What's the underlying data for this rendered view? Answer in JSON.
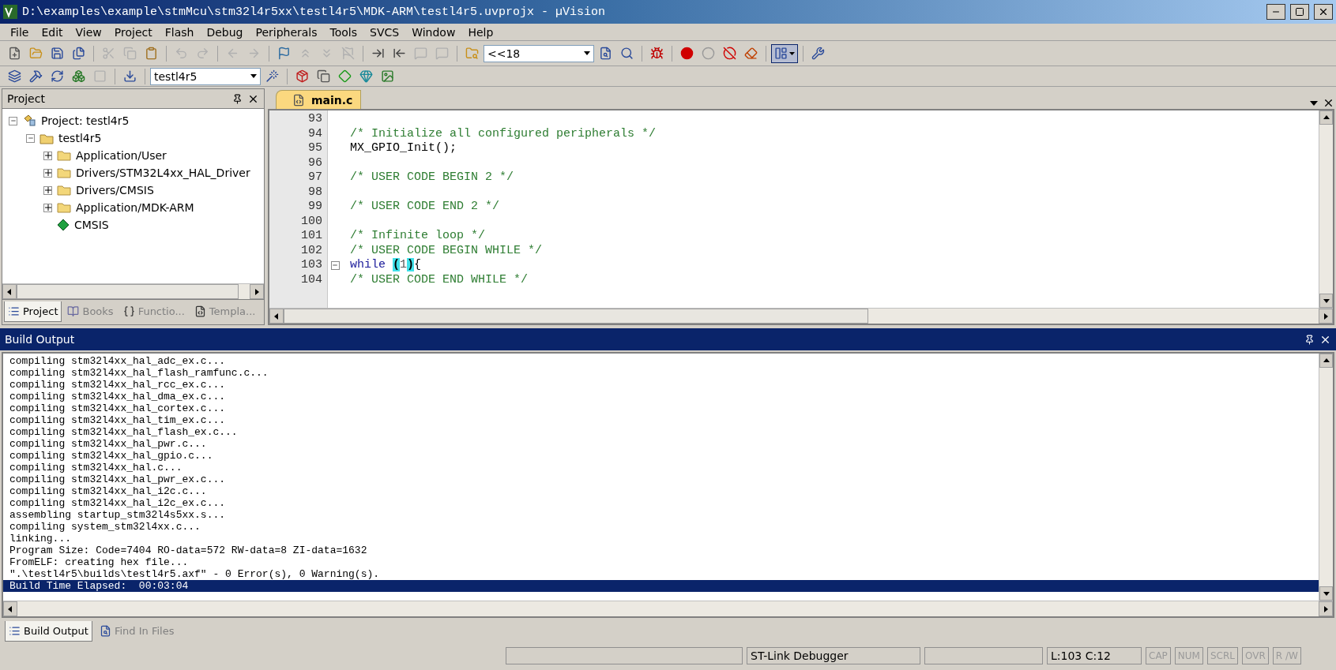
{
  "window": {
    "title": "D:\\examples\\example\\stmMcu\\stm32l4r5xx\\testl4r5\\MDK-ARM\\testl4r5.uvprojx - µVision"
  },
  "menu": [
    "File",
    "Edit",
    "View",
    "Project",
    "Flash",
    "Debug",
    "Peripherals",
    "Tools",
    "SVCS",
    "Window",
    "Help"
  ],
  "toolbar": {
    "buttons": [
      {
        "kind": "new",
        "disabled": false
      },
      {
        "kind": "open",
        "disabled": false
      },
      {
        "kind": "save",
        "disabled": false
      },
      {
        "kind": "saveall",
        "disabled": false
      },
      {
        "kind": "sep"
      },
      {
        "kind": "cut",
        "disabled": true
      },
      {
        "kind": "copy",
        "disabled": true
      },
      {
        "kind": "paste",
        "disabled": false
      },
      {
        "kind": "sep"
      },
      {
        "kind": "undo",
        "disabled": true
      },
      {
        "kind": "redo",
        "disabled": true
      },
      {
        "kind": "sep"
      },
      {
        "kind": "back",
        "disabled": true
      },
      {
        "kind": "forward",
        "disabled": true
      },
      {
        "kind": "sep"
      },
      {
        "kind": "flag",
        "disabled": false
      },
      {
        "kind": "up",
        "disabled": true
      },
      {
        "kind": "down",
        "disabled": true
      },
      {
        "kind": "flagoff",
        "disabled": true
      },
      {
        "kind": "sep"
      },
      {
        "kind": "indent",
        "disabled": false
      },
      {
        "kind": "outdent",
        "disabled": false
      },
      {
        "kind": "comment",
        "disabled": true
      },
      {
        "kind": "uncomment",
        "disabled": true
      },
      {
        "kind": "sep"
      },
      {
        "kind": "findfolder",
        "disabled": false
      },
      {
        "kind": "combo"
      },
      {
        "kind": "filesearch",
        "disabled": false
      },
      {
        "kind": "search",
        "disabled": false
      },
      {
        "kind": "sep"
      },
      {
        "kind": "debug",
        "disabled": false
      },
      {
        "kind": "sep"
      },
      {
        "kind": "breakpoint",
        "disabled": false
      },
      {
        "kind": "breakpointoff",
        "disabled": false
      },
      {
        "kind": "circles",
        "disabled": false
      },
      {
        "kind": "clear",
        "disabled": false
      },
      {
        "kind": "sep"
      },
      {
        "kind": "layout",
        "disabled": false,
        "pressed": true
      },
      {
        "kind": "sep"
      },
      {
        "kind": "wrench",
        "disabled": false
      }
    ],
    "find_combo": "<<18"
  },
  "build_toolbar": {
    "buttons": [
      {
        "kind": "translate",
        "disabled": false
      },
      {
        "kind": "build",
        "disabled": false
      },
      {
        "kind": "rebuild",
        "disabled": false
      },
      {
        "kind": "batch",
        "disabled": false
      },
      {
        "kind": "stop",
        "disabled": true
      },
      {
        "kind": "sep"
      },
      {
        "kind": "download",
        "disabled": false
      },
      {
        "kind": "sep"
      },
      {
        "kind": "combo"
      },
      {
        "kind": "wand",
        "disabled": false
      },
      {
        "kind": "sep"
      },
      {
        "kind": "package",
        "disabled": false
      },
      {
        "kind": "copy",
        "disabled": false
      },
      {
        "kind": "diamond",
        "disabled": false
      },
      {
        "kind": "gem",
        "disabled": false
      },
      {
        "kind": "image",
        "disabled": false
      }
    ],
    "target_combo": "testl4r5"
  },
  "project_panel": {
    "title": "Project",
    "tree": [
      {
        "label": "Project: testl4r5",
        "kind": "project",
        "expanded": true,
        "children": [
          {
            "label": "testl4r5",
            "kind": "target",
            "expanded": true,
            "children": [
              {
                "label": "Application/User",
                "kind": "group",
                "expanded": false
              },
              {
                "label": "Drivers/STM32L4xx_HAL_Driver",
                "kind": "group",
                "expanded": false
              },
              {
                "label": "Drivers/CMSIS",
                "kind": "group",
                "expanded": false
              },
              {
                "label": "Application/MDK-ARM",
                "kind": "group",
                "expanded": false
              },
              {
                "label": "CMSIS",
                "kind": "component"
              }
            ]
          }
        ]
      }
    ],
    "tabs": [
      {
        "label": "Project",
        "kind": "project",
        "selected": true
      },
      {
        "label": "Books",
        "kind": "books",
        "selected": false
      },
      {
        "label": "Functio...",
        "kind": "functions",
        "selected": false
      },
      {
        "label": "Templa...",
        "kind": "templates",
        "selected": false
      }
    ]
  },
  "editor": {
    "tabs": [
      {
        "label": "main.c",
        "selected": true
      }
    ],
    "lines": [
      {
        "number": "93",
        "fold": false
      },
      {
        "number": "94",
        "fold": false,
        "segments": [
          {
            "text": "/* Initialize all configured peripherals */",
            "kind": "comment"
          }
        ]
      },
      {
        "number": "95",
        "fold": false,
        "segments": [
          {
            "text": "MX_GPIO_Init();",
            "kind": "code"
          }
        ]
      },
      {
        "number": "96",
        "fold": false
      },
      {
        "number": "97",
        "fold": false,
        "segments": [
          {
            "text": "/* USER CODE BEGIN 2 */",
            "kind": "comment"
          }
        ]
      },
      {
        "number": "98",
        "fold": false
      },
      {
        "number": "99",
        "fold": false,
        "segments": [
          {
            "text": "/* USER CODE END 2 */",
            "kind": "comment"
          }
        ]
      },
      {
        "number": "100",
        "fold": false
      },
      {
        "number": "101",
        "fold": false,
        "segments": [
          {
            "text": "/* Infinite loop */",
            "kind": "comment"
          }
        ]
      },
      {
        "number": "102",
        "fold": false,
        "segments": [
          {
            "text": "/* USER CODE BEGIN WHILE */",
            "kind": "comment"
          }
        ]
      },
      {
        "number": "103",
        "fold": true,
        "segments": [
          {
            "text": "while ",
            "kind": "keyword"
          },
          {
            "text": "(",
            "kind": "match"
          },
          {
            "text": "1",
            "kind": "number"
          },
          {
            "text": ")",
            "kind": "match"
          },
          {
            "text": "{",
            "kind": "code"
          }
        ]
      },
      {
        "number": "104",
        "fold": false,
        "segments": [
          {
            "text": "/* USER CODE END WHILE */",
            "kind": "comment"
          }
        ]
      }
    ]
  },
  "build_output": {
    "title": "Build Output",
    "lines": [
      {
        "text": "compiling stm32l4xx_hal_adc_ex.c...",
        "selected": false
      },
      {
        "text": "compiling stm32l4xx_hal_flash_ramfunc.c...",
        "selected": false
      },
      {
        "text": "compiling stm32l4xx_hal_rcc_ex.c...",
        "selected": false
      },
      {
        "text": "compiling stm32l4xx_hal_dma_ex.c...",
        "selected": false
      },
      {
        "text": "compiling stm32l4xx_hal_cortex.c...",
        "selected": false
      },
      {
        "text": "compiling stm32l4xx_hal_tim_ex.c...",
        "selected": false
      },
      {
        "text": "compiling stm32l4xx_hal_flash_ex.c...",
        "selected": false
      },
      {
        "text": "compiling stm32l4xx_hal_pwr.c...",
        "selected": false
      },
      {
        "text": "compiling stm32l4xx_hal_gpio.c...",
        "selected": false
      },
      {
        "text": "compiling stm32l4xx_hal.c...",
        "selected": false
      },
      {
        "text": "compiling stm32l4xx_hal_pwr_ex.c...",
        "selected": false
      },
      {
        "text": "compiling stm32l4xx_hal_i2c.c...",
        "selected": false
      },
      {
        "text": "compiling stm32l4xx_hal_i2c_ex.c...",
        "selected": false
      },
      {
        "text": "assembling startup_stm32l4s5xx.s...",
        "selected": false
      },
      {
        "text": "compiling system_stm32l4xx.c...",
        "selected": false
      },
      {
        "text": "linking...",
        "selected": false
      },
      {
        "text": "Program Size: Code=7404 RO-data=572 RW-data=8 ZI-data=1632",
        "selected": false
      },
      {
        "text": "FromELF: creating hex file...",
        "selected": false
      },
      {
        "text": "\".\\testl4r5\\builds\\testl4r5.axf\" - 0 Error(s), 0 Warning(s).",
        "selected": false
      },
      {
        "text": "Build Time Elapsed:  00:03:04",
        "selected": true
      }
    ]
  },
  "bottom_tabs": [
    {
      "label": "Build Output",
      "kind": "build",
      "selected": true
    },
    {
      "label": "Find In Files",
      "kind": "find",
      "selected": false
    }
  ],
  "status_bar": {
    "debugger": "ST-Link Debugger",
    "position": "L:103 C:12",
    "indicators": [
      {
        "text": "CAP",
        "active": false
      },
      {
        "text": "NUM",
        "active": false
      },
      {
        "text": "SCRL",
        "active": false
      },
      {
        "text": "OVR",
        "active": false
      },
      {
        "text": "R /W",
        "active": false
      }
    ]
  }
}
